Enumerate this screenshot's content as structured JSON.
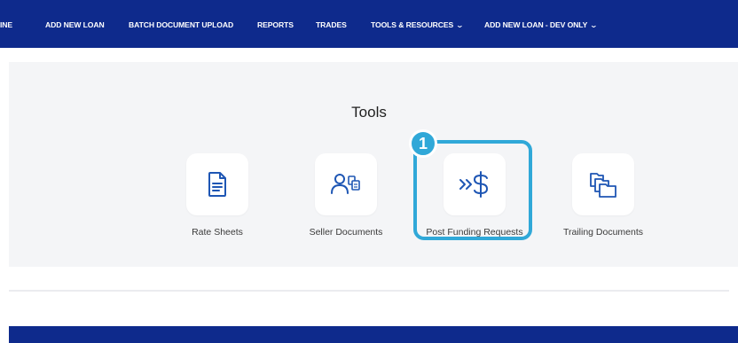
{
  "nav": {
    "items": [
      {
        "label": "INE"
      },
      {
        "label": "ADD NEW LOAN"
      },
      {
        "label": "BATCH DOCUMENT UPLOAD"
      },
      {
        "label": "REPORTS"
      },
      {
        "label": "TRADES"
      },
      {
        "label": "TOOLS & RESOURCES",
        "dropdown": true
      },
      {
        "label": "ADD NEW LOAN - DEV ONLY",
        "dropdown": true
      }
    ],
    "chevron": "⌄"
  },
  "tools": {
    "title": "Tools",
    "items": [
      {
        "label": "Rate Sheets",
        "icon": "document-icon"
      },
      {
        "label": "Seller Documents",
        "icon": "user-documents-icon"
      },
      {
        "label": "Post Funding Requests",
        "icon": "dollar-arrows-icon",
        "highlighted": true
      },
      {
        "label": "Trailing Documents",
        "icon": "folders-icon"
      }
    ]
  },
  "annotation": {
    "step_number": "1"
  },
  "colors": {
    "nav_bg": "#0e2a8c",
    "icon_blue": "#1e56b4",
    "highlight": "#30a8d8",
    "panel_bg": "#f4f5f7"
  }
}
